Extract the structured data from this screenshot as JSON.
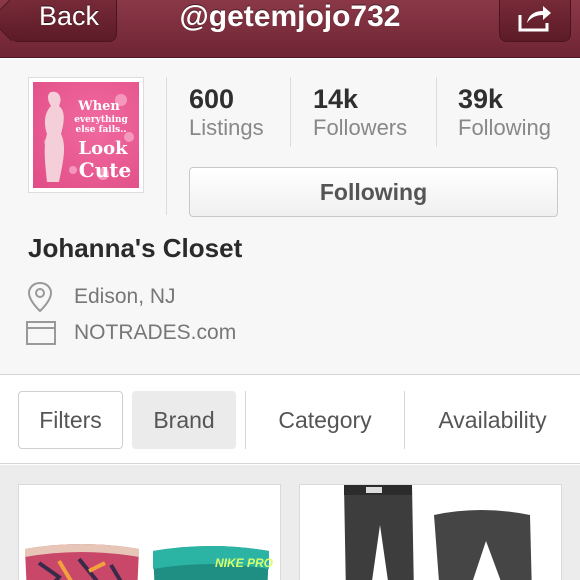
{
  "navbar": {
    "back_label": "Back",
    "title": "@getemjojo732",
    "share_icon": "share-icon"
  },
  "profile": {
    "avatar_text": [
      "When",
      "everything",
      "else fails..",
      "Look",
      "Cute"
    ],
    "stats": [
      {
        "value": "600",
        "label": "Listings"
      },
      {
        "value": "14k",
        "label": "Followers"
      },
      {
        "value": "39k",
        "label": "Following"
      }
    ],
    "follow_button": "Following",
    "closet_name": "Johanna's Closet",
    "location": "Edison, NJ",
    "website": "NOTRADES.com"
  },
  "filters": {
    "items": [
      "Filters",
      "Brand",
      "Category",
      "Availability"
    ],
    "selected": "Brand"
  },
  "listings": {
    "card_1": {
      "text": "NIKE PRO"
    },
    "card_2": {
      "text": ""
    }
  },
  "colors": {
    "navbar": "#7a2c3a",
    "avatar_pink": "#e14d86",
    "background": "#f7f7f7"
  }
}
